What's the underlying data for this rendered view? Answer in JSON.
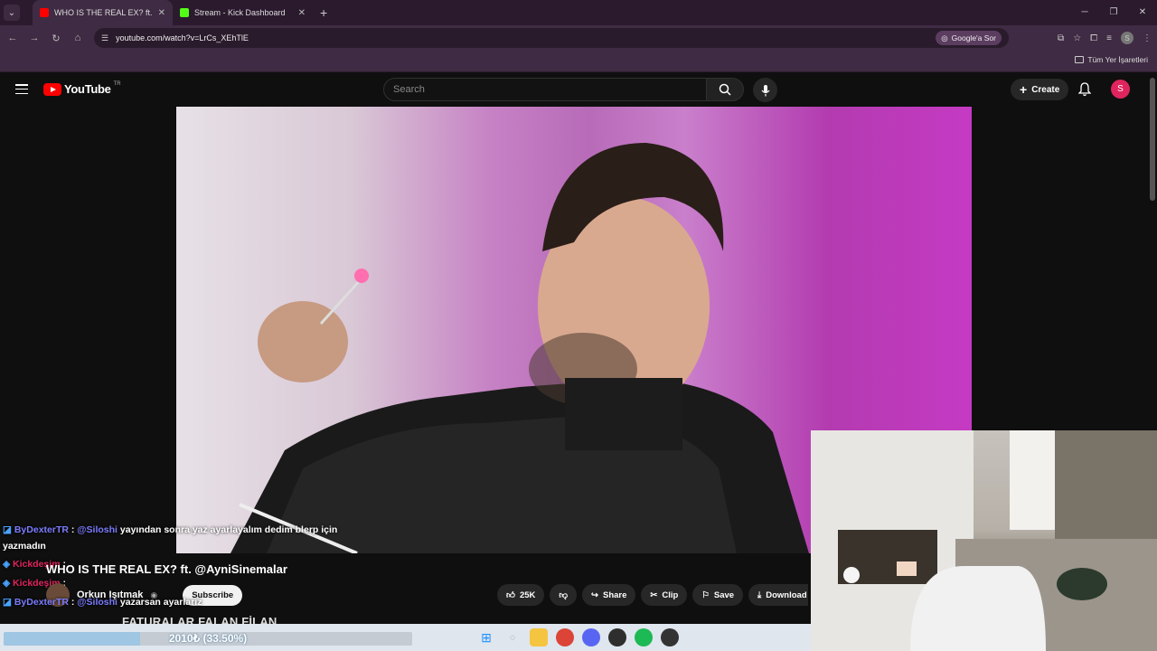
{
  "browser": {
    "tabs": [
      {
        "title": "WHO IS THE REAL EX? ft. @Ayn",
        "active": true,
        "icon": "youtube-icon",
        "color": "#ff0000"
      },
      {
        "title": "Stream - Kick Dashboard",
        "active": false,
        "icon": "kick-icon",
        "color": "#53fc18"
      }
    ],
    "url": "youtube.com/watch?v=LrCs_XEhTlE",
    "ask_google": "Google'a Sor",
    "profile_initial": "S",
    "bookmarks_all": "Tüm Yer İşaretleri",
    "accent": "#3f2b43"
  },
  "youtube": {
    "logo_text": "YouTube",
    "country": "TR",
    "search_placeholder": "Search",
    "create_label": "Create",
    "avatar_initial": "S"
  },
  "video": {
    "title": "WHO IS THE REAL EX? ft. @AyniSinemalar",
    "channel": "Orkun Işıtmak",
    "subscribe_label": "Subscribe",
    "likes": "25K",
    "share_label": "Share",
    "clip_label": "Clip",
    "save_label": "Save",
    "download_label": "Download"
  },
  "chat": [
    {
      "user": "ByDexterTR",
      "mention": "@Siloshi",
      "text": "yayından sonra yaz ayarlayalım dedim blerp için"
    },
    {
      "text": "yazmadın"
    },
    {
      "user": "Kickdeşim",
      "text": ":"
    },
    {
      "user": "Kickdeşim",
      "text": ":"
    },
    {
      "user": "ByDexterTR",
      "mention": "@Siloshi",
      "text": "yazarsan ayarlarız"
    }
  ],
  "overlay": {
    "ticker": "FATURALAR FALAN FİLAN",
    "progress_label": "2010₺ (33.50%)",
    "progress": 0.335
  }
}
